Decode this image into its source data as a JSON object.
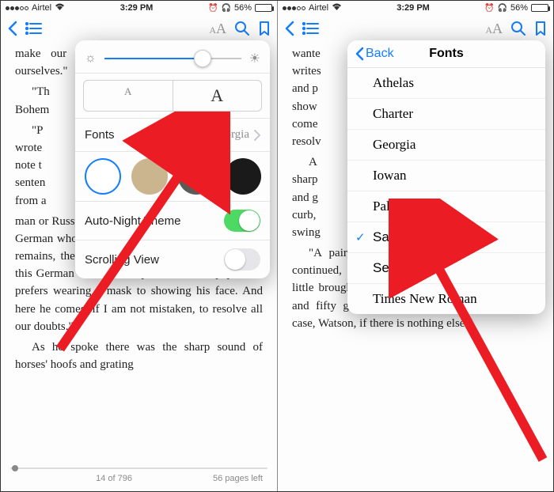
{
  "status": {
    "carrier": "Airtel",
    "wifi": "▲",
    "time": "3:29 PM",
    "battery_pct": "56%",
    "battery_fill": 56
  },
  "left": {
    "page_text": {
      "p1": "make our own conjecture on his cloud for ourselves.\"",
      "p2a": "\"Th",
      "p2b": "Bohem",
      "p3a": "\"P",
      "p3b": "wrote",
      "p3c": "note t",
      "p3d": "senten",
      "p3e": "from a",
      "p4": "man or Russian could not have written that. It is the German who is so uncourteous to his verbs. It only remains, therefore, to discover what is wanted by this German who writes upon Bohemian paper and prefers wearing a mask to showing his face. And here he comes, if I am not mistak­en, to resolve all our doubts.\"",
      "p5": "As he spoke there was the sharp sound of horses' hoofs and grating"
    },
    "popover": {
      "size_small": "A",
      "size_large": "A",
      "fonts_label": "Fonts",
      "fonts_value": "Georgia",
      "auto_night": "Auto-Night Theme",
      "scrolling": "Scrolling View"
    },
    "footer": {
      "page_of": "14 of 796",
      "pages_left": "56 pages left"
    }
  },
  "right": {
    "page_text": {
      "p1a": "wante",
      "p1b": "writes",
      "p1c": "and p",
      "p1d": "show",
      "p1e": "come",
      "p1f": "resolv",
      "p2a": "A",
      "p2b": "sharp",
      "p2c": "and g",
      "p2d": "curb,",
      "p2e": "swing",
      "p3": "\"A pair, by the sound,\" said he. \"Yes,\" he continued, glanc­ing out of the window. \"A nice little brougham and a pair of beauties. A hundred and fifty guineas apiece. There's money in this case, Watson, if there is nothing else.\""
    },
    "fonts_panel": {
      "back": "Back",
      "title": "Fonts",
      "items": [
        {
          "label": "Athelas",
          "cls": "ff-athelas",
          "selected": false
        },
        {
          "label": "Charter",
          "cls": "ff-charter",
          "selected": false
        },
        {
          "label": "Georgia",
          "cls": "ff-georgia",
          "selected": false
        },
        {
          "label": "Iowan",
          "cls": "ff-iowan",
          "selected": false
        },
        {
          "label": "Palatino",
          "cls": "ff-palatino",
          "selected": false
        },
        {
          "label": "San Francisco",
          "cls": "ff-sanfran",
          "selected": true
        },
        {
          "label": "Seravek",
          "cls": "ff-seravek",
          "selected": false
        },
        {
          "label": "Times New Roman",
          "cls": "ff-times",
          "selected": false
        }
      ]
    }
  }
}
